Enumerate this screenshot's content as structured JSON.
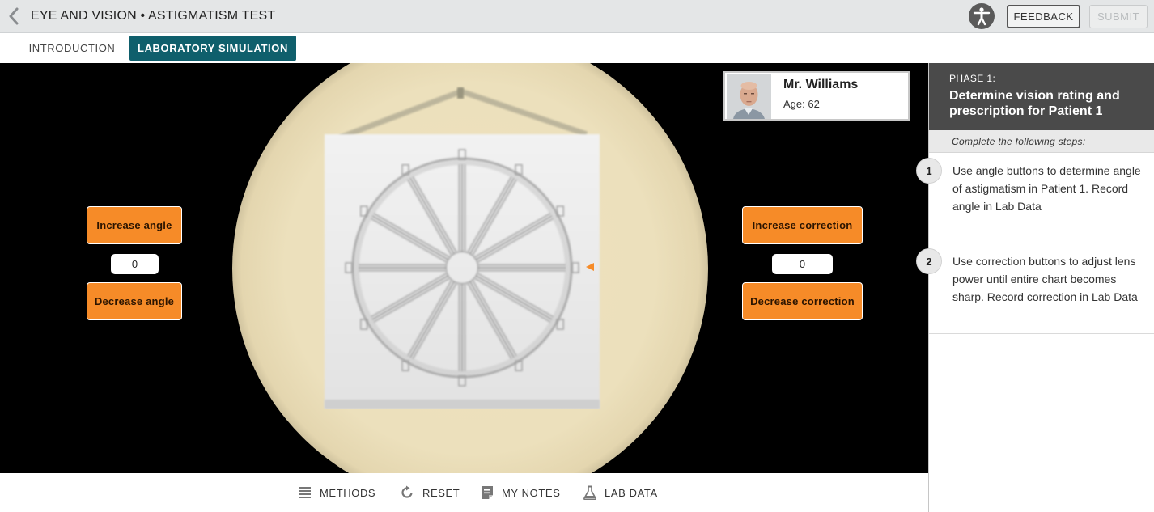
{
  "header": {
    "title": "EYE AND VISION • ASTIGMATISM TEST",
    "feedback_label": "FEEDBACK",
    "submit_label": "SUBMIT"
  },
  "tabs": [
    {
      "label": "INTRODUCTION",
      "active": false
    },
    {
      "label": "LABORATORY SIMULATION",
      "active": true
    }
  ],
  "patient": {
    "name": "Mr. Williams",
    "age": "Age: 62"
  },
  "controls": {
    "increase_angle": "Increase angle",
    "decrease_angle": "Decrease angle",
    "angle_value": "0",
    "increase_correction": "Increase correction",
    "decrease_correction": "Decrease correction",
    "correction_value": "0"
  },
  "toolbar": {
    "methods": "METHODS",
    "reset": "RESET",
    "notes": "MY NOTES",
    "lab_data": "LAB DATA"
  },
  "panel": {
    "phase_label": "PHASE 1:",
    "phase_title": "Determine vision rating and prescription for Patient 1",
    "steps_header": "Complete the following steps:",
    "steps": [
      {
        "num": "1",
        "text": "Use angle buttons to determine angle of astigmatism in Patient 1. Record angle in Lab Data"
      },
      {
        "num": "2",
        "text": "Use correction buttons to adjust lens power until entire chart becomes sharp. Record correction in Lab Data"
      }
    ]
  },
  "colors": {
    "accent_teal": "#0f5f6c",
    "button_orange": "#f68b28",
    "indicator_orange": "#f68b28",
    "panel_header": "#4a4a4a"
  },
  "icons": {
    "back": "chevron-left-icon",
    "accessibility": "accessibility-icon",
    "methods": "list-icon",
    "reset": "refresh-icon",
    "notes": "notepad-icon",
    "lab_data": "flask-icon"
  }
}
